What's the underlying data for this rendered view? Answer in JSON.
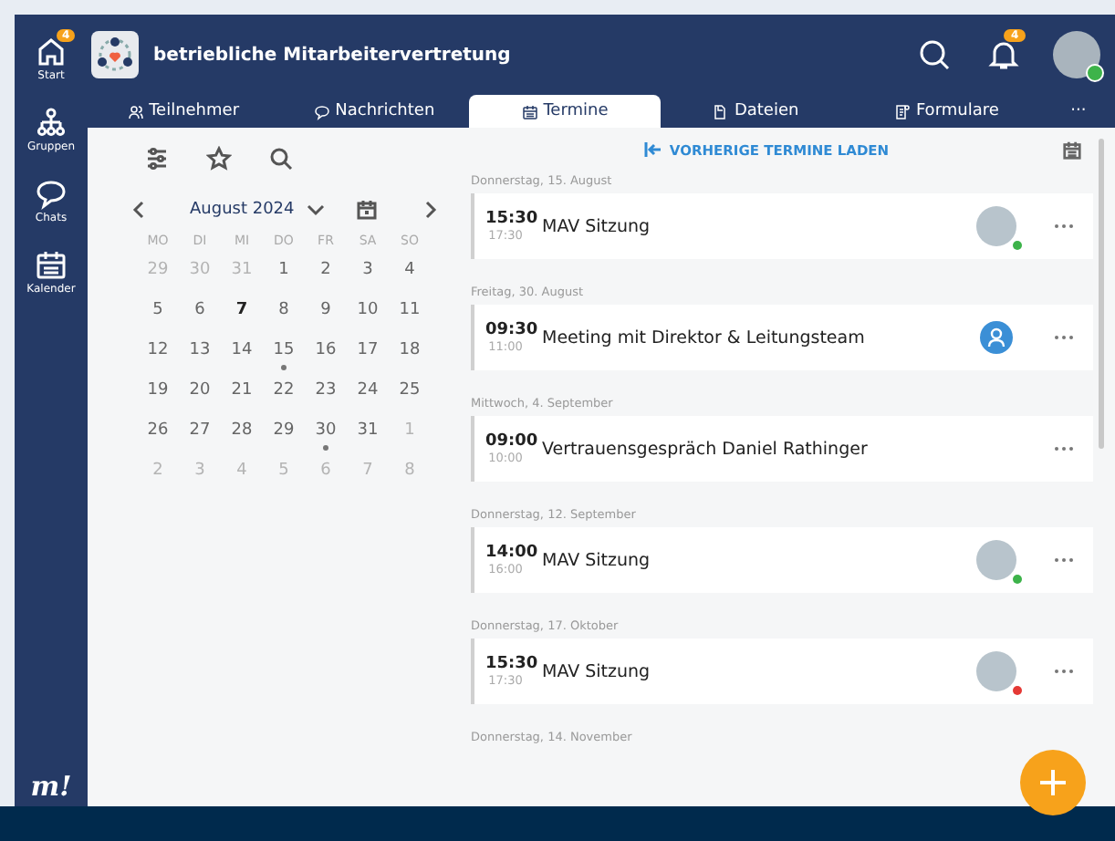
{
  "sidebar": {
    "items": [
      {
        "label": "Start",
        "badge": "4"
      },
      {
        "label": "Gruppen"
      },
      {
        "label": "Chats"
      },
      {
        "label": "Kalender"
      }
    ],
    "logo": "m!"
  },
  "header": {
    "title": "betriebliche Mitarbeitervertretung",
    "notification_badge": "4"
  },
  "tabs": [
    {
      "label": "Teilnehmer",
      "selected": false
    },
    {
      "label": "Nachrichten",
      "selected": false
    },
    {
      "label": "Termine",
      "selected": true
    },
    {
      "label": "Dateien",
      "selected": false
    },
    {
      "label": "Formulare",
      "selected": false
    },
    {
      "label": "···",
      "selected": false
    }
  ],
  "calendar": {
    "month": "August 2024",
    "weekdays": [
      "MO",
      "DI",
      "MI",
      "DO",
      "FR",
      "SA",
      "SO"
    ],
    "weeks": [
      [
        {
          "day": "29",
          "muted": true,
          "today": false,
          "event": false
        },
        {
          "day": "30",
          "muted": true,
          "today": false,
          "event": false
        },
        {
          "day": "31",
          "muted": true,
          "today": false,
          "event": false
        },
        {
          "day": "1",
          "muted": false,
          "today": false,
          "event": false
        },
        {
          "day": "2",
          "muted": false,
          "today": false,
          "event": false
        },
        {
          "day": "3",
          "muted": false,
          "today": false,
          "event": false
        },
        {
          "day": "4",
          "muted": false,
          "today": false,
          "event": false
        }
      ],
      [
        {
          "day": "5",
          "muted": false,
          "today": false,
          "event": false
        },
        {
          "day": "6",
          "muted": false,
          "today": false,
          "event": false
        },
        {
          "day": "7",
          "muted": false,
          "today": true,
          "event": false
        },
        {
          "day": "8",
          "muted": false,
          "today": false,
          "event": false
        },
        {
          "day": "9",
          "muted": false,
          "today": false,
          "event": false
        },
        {
          "day": "10",
          "muted": false,
          "today": false,
          "event": false
        },
        {
          "day": "11",
          "muted": false,
          "today": false,
          "event": false
        }
      ],
      [
        {
          "day": "12",
          "muted": false,
          "today": false,
          "event": false
        },
        {
          "day": "13",
          "muted": false,
          "today": false,
          "event": false
        },
        {
          "day": "14",
          "muted": false,
          "today": false,
          "event": false
        },
        {
          "day": "15",
          "muted": false,
          "today": false,
          "event": true
        },
        {
          "day": "16",
          "muted": false,
          "today": false,
          "event": false
        },
        {
          "day": "17",
          "muted": false,
          "today": false,
          "event": false
        },
        {
          "day": "18",
          "muted": false,
          "today": false,
          "event": false
        }
      ],
      [
        {
          "day": "19",
          "muted": false,
          "today": false,
          "event": false
        },
        {
          "day": "20",
          "muted": false,
          "today": false,
          "event": false
        },
        {
          "day": "21",
          "muted": false,
          "today": false,
          "event": false
        },
        {
          "day": "22",
          "muted": false,
          "today": false,
          "event": false
        },
        {
          "day": "23",
          "muted": false,
          "today": false,
          "event": false
        },
        {
          "day": "24",
          "muted": false,
          "today": false,
          "event": false
        },
        {
          "day": "25",
          "muted": false,
          "today": false,
          "event": false
        }
      ],
      [
        {
          "day": "26",
          "muted": false,
          "today": false,
          "event": false
        },
        {
          "day": "27",
          "muted": false,
          "today": false,
          "event": false
        },
        {
          "day": "28",
          "muted": false,
          "today": false,
          "event": false
        },
        {
          "day": "29",
          "muted": false,
          "today": false,
          "event": false
        },
        {
          "day": "30",
          "muted": false,
          "today": false,
          "event": true
        },
        {
          "day": "31",
          "muted": false,
          "today": false,
          "event": false
        },
        {
          "day": "1",
          "muted": true,
          "today": false,
          "event": false
        }
      ],
      [
        {
          "day": "2",
          "muted": true,
          "today": false,
          "event": false
        },
        {
          "day": "3",
          "muted": true,
          "today": false,
          "event": false
        },
        {
          "day": "4",
          "muted": true,
          "today": false,
          "event": false
        },
        {
          "day": "5",
          "muted": true,
          "today": false,
          "event": false
        },
        {
          "day": "6",
          "muted": true,
          "today": false,
          "event": false
        },
        {
          "day": "7",
          "muted": true,
          "today": false,
          "event": false
        },
        {
          "day": "8",
          "muted": true,
          "today": false,
          "event": false
        }
      ]
    ]
  },
  "load_previous": "VORHERIGE TERMINE LADEN",
  "events": [
    {
      "date": "Donnerstag, 15. August",
      "start": "15:30",
      "end": "17:30",
      "title": "MAV Sitzung",
      "kind": "photo",
      "color": "#3db34a"
    },
    {
      "date": "Freitag, 30. August",
      "start": "09:30",
      "end": "11:00",
      "title": "Meeting mit Direktor & Leitungsteam",
      "kind": "person"
    },
    {
      "date": "Mittwoch, 4. September",
      "start": "09:00",
      "end": "10:00",
      "title": "Vertrauensgespräch Daniel Rathinger",
      "kind": "plain"
    },
    {
      "date": "Donnerstag, 12. September",
      "start": "14:00",
      "end": "16:00",
      "title": "MAV Sitzung",
      "kind": "photo",
      "color": "#3db34a"
    },
    {
      "date": "Donnerstag, 17. Oktober",
      "start": "15:30",
      "end": "17:30",
      "title": "MAV Sitzung",
      "kind": "photo",
      "color": "#e53935"
    }
  ],
  "next_date": "Donnerstag, 14. November"
}
